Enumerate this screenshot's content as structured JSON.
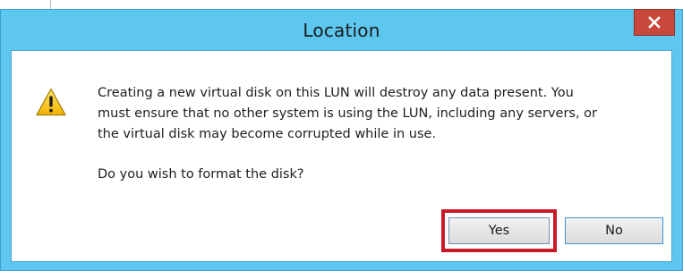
{
  "dialog": {
    "title": "Location",
    "close_label": "x",
    "icon": "warning-icon",
    "message": "Creating a new virtual disk on this LUN will destroy any data present. You\nmust ensure that no other system is using the LUN, including any servers, or\nthe virtual disk may become corrupted while in use.",
    "question": "Do you wish to format the disk?",
    "buttons": {
      "yes": "Yes",
      "no": "No"
    },
    "highlight_color": "#c8192b",
    "titlebar_color": "#5ec7ef"
  }
}
